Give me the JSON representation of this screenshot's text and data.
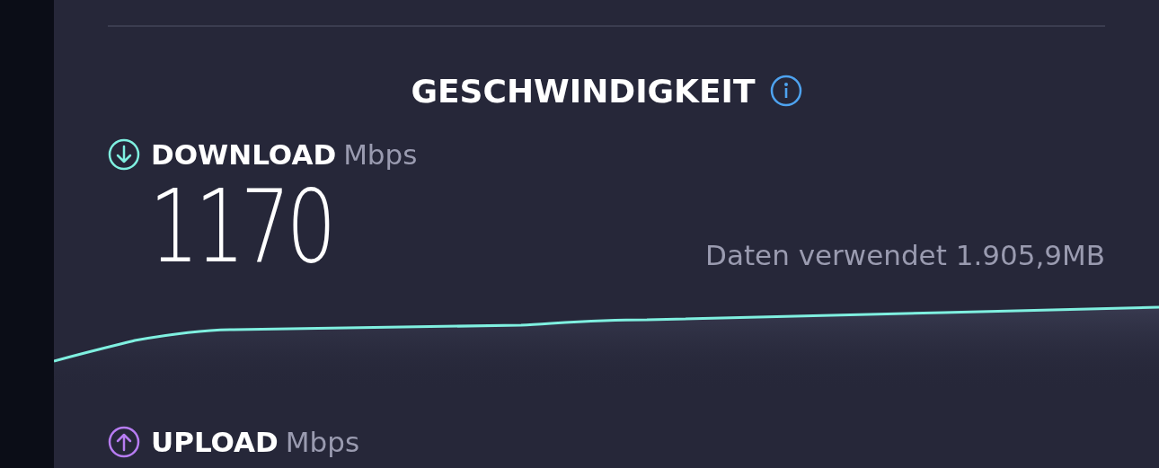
{
  "section_title": "GESCHWINDIGKEIT",
  "download": {
    "label": "DOWNLOAD",
    "unit": "Mbps",
    "value": "1170",
    "data_used": "Daten verwendet 1.905,9MB"
  },
  "upload": {
    "label": "UPLOAD",
    "unit": "Mbps"
  }
}
